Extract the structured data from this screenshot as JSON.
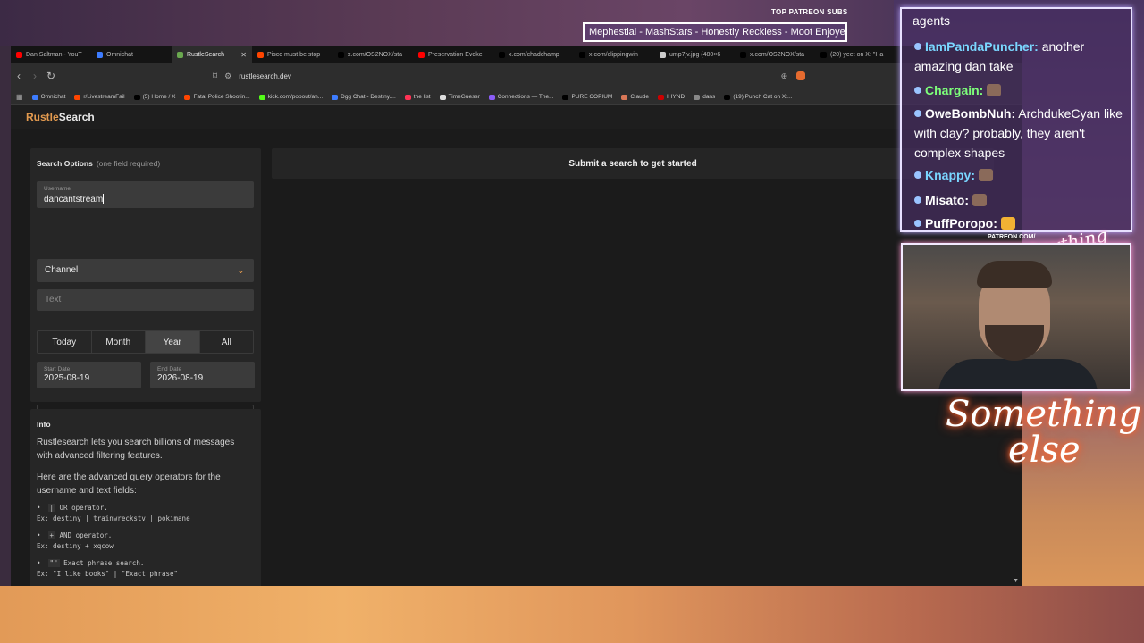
{
  "browser": {
    "tabs": [
      {
        "label": "Dan Saltman - YouT",
        "color": "#ff0000",
        "active": false
      },
      {
        "label": "Omnichat",
        "color": "#3d7cff",
        "active": false
      },
      {
        "label": "RustleSearch",
        "color": "#6aa84f",
        "active": true
      },
      {
        "label": "Pisco must be stop",
        "color": "#ff4500",
        "active": false
      },
      {
        "label": "x.com/OS2NOX/sta",
        "color": "#000000",
        "active": false
      },
      {
        "label": "Preservation Evoke",
        "color": "#ff0000",
        "active": false
      },
      {
        "label": "x.com/chadchamp",
        "color": "#000000",
        "active": false
      },
      {
        "label": "x.com/clippingwin",
        "color": "#000000",
        "active": false
      },
      {
        "label": "ump7jv.jpg (480×6",
        "color": "#cccccc",
        "active": false
      },
      {
        "label": "x.com/OS2NOX/sta",
        "color": "#000000",
        "active": false
      },
      {
        "label": "(20) yeet on X: \"Ha",
        "color": "#000000",
        "active": false
      }
    ],
    "close_glyph": "✕",
    "url": "rustlesearch.dev",
    "bookmarks": [
      {
        "label": "Omnichat",
        "color": "#3d7cff"
      },
      {
        "label": "r/LivestreamFail",
        "color": "#ff4500"
      },
      {
        "label": "(5) Home / X",
        "color": "#000000"
      },
      {
        "label": "Fatal Police Shootin...",
        "color": "#ff4500"
      },
      {
        "label": "kick.com/popout/an...",
        "color": "#53fc18"
      },
      {
        "label": "Dgg Chat - Destiny....",
        "color": "#3d7cff"
      },
      {
        "label": "the list",
        "color": "#ff3355"
      },
      {
        "label": "TimeGuessr",
        "color": "#dddddd"
      },
      {
        "label": "Connections — The...",
        "color": "#8a5cf6"
      },
      {
        "label": "PURE COPIUM",
        "color": "#000000"
      },
      {
        "label": "Claude",
        "color": "#d97757"
      },
      {
        "label": "IHYND",
        "color": "#cc0000"
      },
      {
        "label": "dans",
        "color": "#888888"
      },
      {
        "label": "(19) Punch Cat on X:...",
        "color": "#000000"
      }
    ]
  },
  "site": {
    "logo_a": "Rustle",
    "logo_b": "Search",
    "search_options_title": "Search Options",
    "search_options_hint": "(one field required)",
    "username_label": "Username",
    "username_value": "dancantstream",
    "channel_value": "Channel",
    "text_placeholder": "Text",
    "ranges": [
      "Today",
      "Month",
      "Year",
      "All"
    ],
    "active_range": "Year",
    "start_label": "Start Date",
    "start_value": "2025-08-19",
    "end_label": "End Date",
    "end_value": "2026-08-19",
    "results_message": "Submit a search to get started",
    "info_title": "Info",
    "info_p1": "Rustlesearch lets you search billions of messages with advanced filtering features.",
    "info_p2": "Here are the advanced query operators for the username and text fields:",
    "operators": [
      {
        "symbol": "|",
        "desc": "OR operator.",
        "example": "Ex: destiny | trainwreckstv | pokimane"
      },
      {
        "symbol": "+",
        "desc": "AND operator.",
        "example": "Ex: destiny + xqcow"
      },
      {
        "symbol": "\"\"",
        "desc": "Exact phrase search.",
        "example": "Ex: \"I like books\" | \"Exact phrase\""
      }
    ],
    "accent": "#e39a4f"
  },
  "overlay": {
    "patreon_label": "TOP PATREON SUBS",
    "song": "Mephestial - MashStars - Honestly Reckless - Moot Enjoye",
    "chat": [
      {
        "name": "",
        "text": "agents",
        "color": "#ffffff"
      },
      {
        "name": "IamPandaPuncher:",
        "text": " another amazing dan take",
        "color": "#7ad6ff"
      },
      {
        "name": "Chargain:",
        "text": "",
        "color": "#7dff7a"
      },
      {
        "name": "OweBombNuh:",
        "text": " ArchdukeCyan like with clay? probably, they aren't complex shapes",
        "color": "#ffffff"
      },
      {
        "name": "Knappy:",
        "text": "",
        "color": "#7ad6ff"
      },
      {
        "name": "Misato:",
        "text": "",
        "color": "#ffffff"
      },
      {
        "name": "PuffPoropo:",
        "text": "",
        "color": "#ffffff"
      }
    ],
    "cam_logo": "PATREON.COM/",
    "cam_title": "Anything else",
    "neon_line1": "Something",
    "neon_line2": "else"
  }
}
